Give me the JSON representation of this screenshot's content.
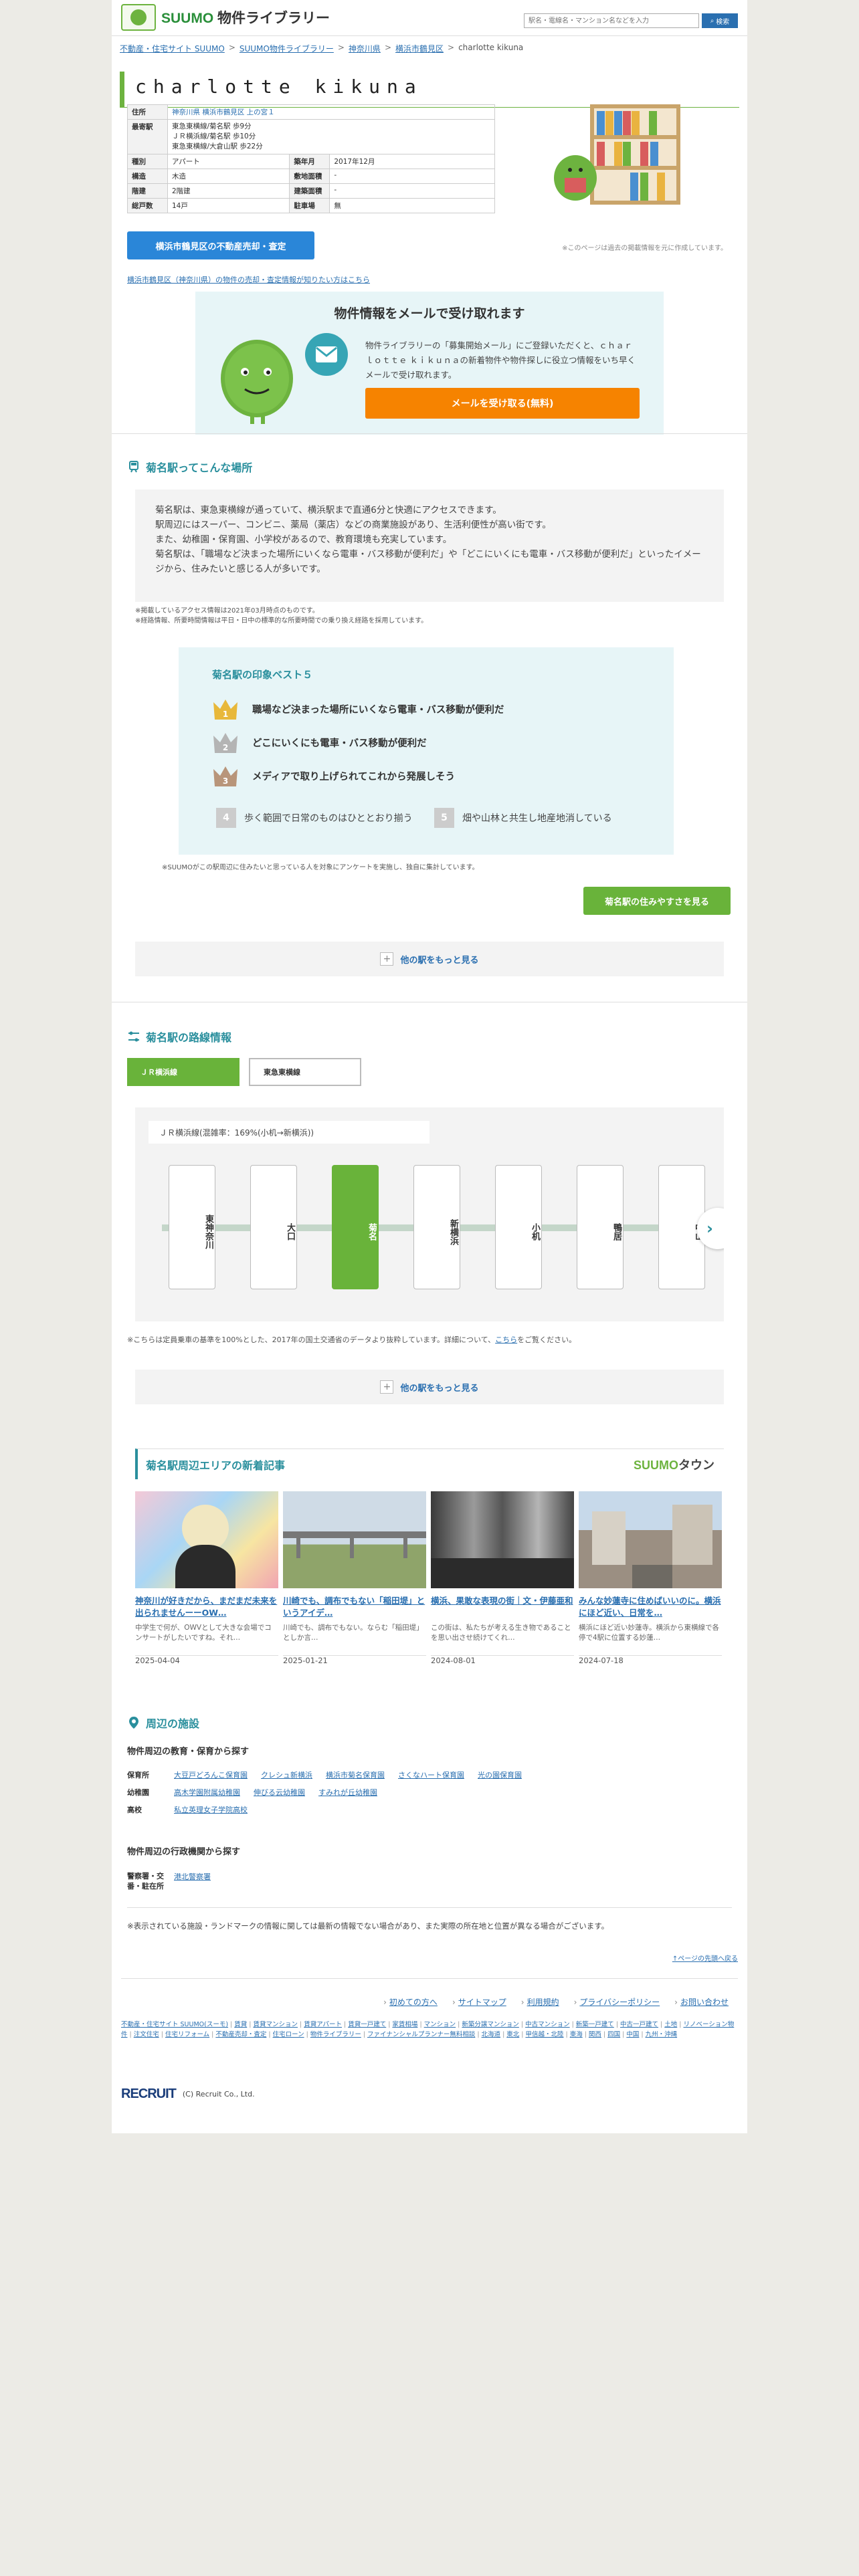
{
  "header": {
    "logo_brand": "SUUMO",
    "logo_product": "物件ライブラリー",
    "search_placeholder": "駅名・電線名・マンション名などを入力",
    "search_button": "検索"
  },
  "breadcrumb": [
    "不動産・住宅サイト SUUMO",
    "SUUMO物件ライブラリー",
    "神奈川県",
    "横浜市鶴見区",
    "charlotte kikuna"
  ],
  "property": {
    "title": "charlotte kikuna",
    "rows": [
      {
        "label": "住所",
        "value": "神奈川県 横浜市鶴見区 上の宮１"
      },
      {
        "label": "最寄駅",
        "value": "東急東横線/菊名駅 歩9分\nＪＲ横浜線/菊名駅 歩10分\n東急東横線/大倉山駅 歩22分"
      }
    ],
    "grid": [
      {
        "l1": "種別",
        "v1": "アパート",
        "l2": "築年月",
        "v2": "2017年12月"
      },
      {
        "l1": "構造",
        "v1": "木造",
        "l2": "敷地面積",
        "v2": "-"
      },
      {
        "l1": "階建",
        "v1": "2階建",
        "l2": "建築面積",
        "v2": "-"
      },
      {
        "l1": "総戸数",
        "v1": "14戸",
        "l2": "駐車場",
        "v2": "無"
      }
    ],
    "note_past": "※このページは過去の掲載情報を元に作成しています。",
    "sell_button": "横浜市鶴見区の不動産売却・査定",
    "sell_link": "横浜市鶴見区（神奈川県）の物件の売却・査定情報が知りたい方はこちら"
  },
  "mail": {
    "heading": "物件情報をメールで受け取れます",
    "text": "物件ライブラリーの「募集開始メール」にご登録いただくと、ｃｈａｒｌｏｔｔｅ ｋｉｋｕｎａの新着物件や物件探しに役立つ情報をいち早くメールで受け取れます。",
    "button": "メールを受け取る(無料)"
  },
  "area": {
    "title": "菊名駅ってこんな場所",
    "desc": "菊名駅は、東急東横線が通っていて、横浜駅まで直通6分と快適にアクセスできます。\n駅周辺にはスーパー、コンビニ、薬局（薬店）などの商業施設があり、生活利便性が高い街です。\nまた、幼稚園・保育園、小学校があるので、教育環境も充実しています。\n菊名駅は、「職場など決まった場所にいくなら電車・バス移動が便利だ」や「どこにいくにも電車・バス移動が便利だ」といったイメージから、住みたいと感じる人が多いです。",
    "notes": "※掲載しているアクセス情報は2021年03月時点のものです。\n※経路情報、所要時間情報は平日・日中の標準的な所要時間での乗り換え経路を採用しています。",
    "best5_title": "菊名駅の印象ベスト５",
    "best5": [
      "職場など決まった場所にいくなら電車・バス移動が便利だ",
      "どこにいくにも電車・バス移動が便利だ",
      "メディアで取り上げられてこれから発展しそう",
      "歩く範囲で日常のものはひととおり揃う",
      "畑や山林と共生し地産地消している"
    ],
    "best5_ranks": [
      "1",
      "2",
      "3",
      "4",
      "5"
    ],
    "survey_note": "※SUUMOがこの駅周辺に住みたいと思っている人を対象にアンケートを実施し、独自に集計しています。",
    "live_button": "菊名駅の住みやすさを見る",
    "more_stations": "他の駅をもっと見る"
  },
  "lines": {
    "title": "菊名駅の路線情報",
    "tabs": [
      "ＪＲ横浜線",
      "東急東横線"
    ],
    "congestion": "ＪＲ横浜線(混雑率：169%(小机→新横浜))",
    "stations": [
      "東神奈川",
      "大口",
      "菊名",
      "新横浜",
      "小机",
      "鴨居",
      "中山"
    ],
    "note_pre": "※こちらは定員乗車の基準を100%とした、2017年の国土交通省のデータより抜粋しています。詳細について、",
    "note_link": "こちら",
    "note_post": "をご覧ください。",
    "more_stations": "他の駅をもっと見る"
  },
  "news": {
    "title": "菊名駅周辺エリアの新着記事",
    "logo_a": "SUUMO",
    "logo_b": "タウン",
    "cards": [
      {
        "headline": "神奈川が好きだから、まだまだ未来を出られませんーーOW…",
        "excerpt": "中学生で何が、OWVとして大きな会場でコンサートがしたいですね。それ…",
        "date": "2025-04-04"
      },
      {
        "headline": "川崎でも、調布でもない「稲田堤」というアイデ…",
        "excerpt": "川崎でも、調布でもない。ならむ「稲田堤」としか言…",
        "date": "2025-01-21"
      },
      {
        "headline": "横浜、果敢な表現の街｜文・伊藤亜和",
        "excerpt": "この街は、私たちが考える生き物であることを思い出させ続けてくれ…",
        "date": "2024-08-01"
      },
      {
        "headline": "みんな妙蓮寺に住めばいいのに。横浜にほど近い、日常を…",
        "excerpt": "横浜にほど近い妙蓮寺。横浜から東横線で各停で4駅に位置する妙蓮…",
        "date": "2024-07-18"
      }
    ]
  },
  "facilities": {
    "title": "周辺の施設",
    "edu_heading": "物件周辺の教育・保育から探す",
    "edu_rows": [
      {
        "label": "保育所",
        "items": [
          "大豆戸どろんこ保育園",
          "クレシュ新横浜",
          "横浜市菊名保育園",
          "さくなハート保育園",
          "光の園保育園"
        ]
      },
      {
        "label": "幼稚園",
        "items": [
          "高木学園附属幼稚園",
          "伸びる云幼稚園",
          "すみれが丘幼稚園"
        ]
      },
      {
        "label": "高校",
        "items": [
          "私立英理女子学院高校"
        ]
      }
    ],
    "gov_heading": "物件周辺の行政機関から探す",
    "gov_rows": [
      {
        "label": "警察署・交番・駐在所",
        "items": [
          "港北警察署"
        ]
      }
    ]
  },
  "footer": {
    "notice": "※表示されている施設・ランドマークの情報に関しては最新の情報でない場合があり、また実際の所在地と位置が異なる場合がございます。",
    "totop": "↑ページの先頭へ戻る",
    "links": [
      "初めての方へ",
      "サイトマップ",
      "利用規約",
      "プライバシーポリシー",
      "お問い合わせ"
    ],
    "site_links": [
      "不動産・住宅サイト SUUMO(スーモ)",
      "賃貸",
      "賃貸マンション",
      "賃貸アパート",
      "賃貸一戸建て",
      "家賃相場",
      "マンション",
      "新築分譲マンション",
      "中古マンション",
      "新築一戸建て",
      "中古一戸建て",
      "土地",
      "リノベーション物件",
      "注文住宅",
      "住宅リフォーム",
      "不動産売却・査定",
      "住宅ローン",
      "物件ライブラリー",
      "ファイナンシャルプランナー無料相談",
      "北海道",
      "東北",
      "甲信越・北陸",
      "東海",
      "関西",
      "四国",
      "中国",
      "九州・沖縄"
    ],
    "recruit": "RECRUIT",
    "copyright": "(C) Recruit Co., Ltd."
  }
}
